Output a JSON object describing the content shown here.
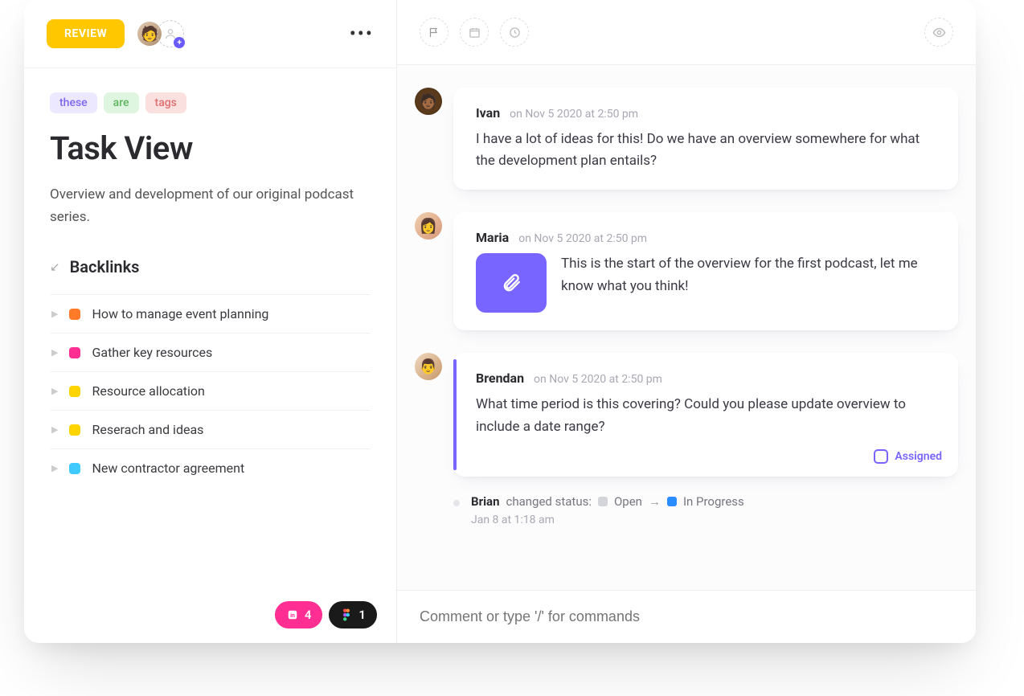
{
  "header": {
    "status_label": "REVIEW",
    "status_color": "#ffc700"
  },
  "tags": [
    {
      "label": "these",
      "kind": "purple"
    },
    {
      "label": "are",
      "kind": "green"
    },
    {
      "label": "tags",
      "kind": "red"
    }
  ],
  "page_title": "Task View",
  "page_description": "Overview and development of our original podcast series.",
  "backlinks": {
    "heading": "Backlinks",
    "items": [
      {
        "color": "#ff7a29",
        "label": "How to manage event planning"
      },
      {
        "color": "#ff2e93",
        "label": "Gather key resources"
      },
      {
        "color": "#ffd400",
        "label": "Resource allocation"
      },
      {
        "color": "#ffd400",
        "label": "Reserach and ideas"
      },
      {
        "color": "#3fc9ff",
        "label": "New contractor agreement"
      }
    ]
  },
  "integrations": {
    "invision_count": "4",
    "figma_count": "1"
  },
  "comments": [
    {
      "author": "Ivan",
      "timestamp": "on Nov 5 2020 at 2:50 pm",
      "body": "I have a lot of ideas for this! Do we have an overview somewhere for what the development plan entails?",
      "avatar": "ivan",
      "attachment": false,
      "highlighted": false
    },
    {
      "author": "Maria",
      "timestamp": "on Nov 5 2020 at 2:50 pm",
      "body": "This is the start of the overview for the first podcast, let me know what you think!",
      "avatar": "maria",
      "attachment": true,
      "highlighted": false
    },
    {
      "author": "Brendan",
      "timestamp": "on Nov 5 2020 at 2:50 pm",
      "body": "What time period is this covering? Could you please update overview to include a date range?",
      "avatar": "brendan",
      "attachment": false,
      "highlighted": true,
      "assigned_label": "Assigned"
    }
  ],
  "activity": {
    "actor": "Brian",
    "action_text": "changed status:",
    "from": "Open",
    "to": "In Progress",
    "timestamp": "Jan 8 at 1:18 am"
  },
  "composer": {
    "placeholder": "Comment or type '/' for commands"
  }
}
